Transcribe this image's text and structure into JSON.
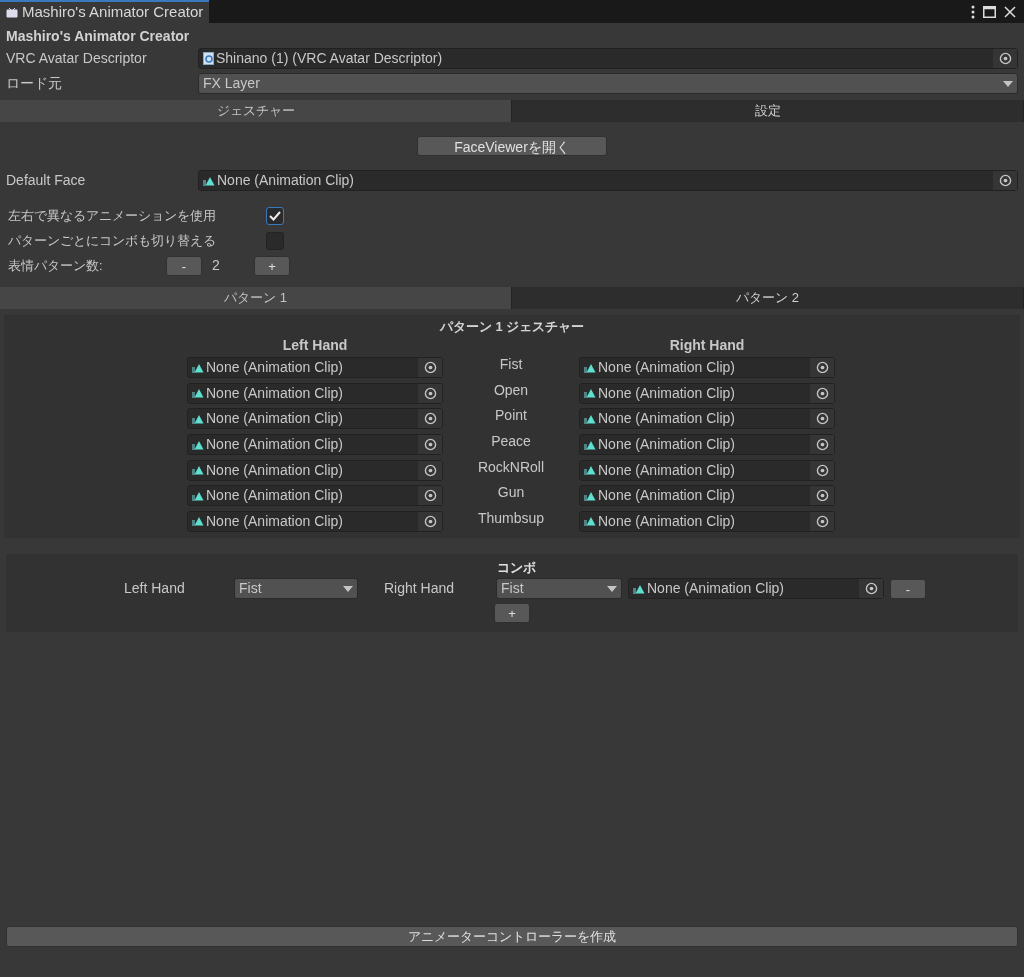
{
  "window": {
    "title": "Mashiro's Animator Creator"
  },
  "header": "Mashiro's Animator Creator",
  "fields": [
    {
      "kind": "object",
      "label": "VRC Avatar Descriptor",
      "value": "Shinano (1) (VRC Avatar Descriptor)"
    },
    {
      "kind": "dropdown",
      "label": "ロード元",
      "value": "FX Layer"
    }
  ],
  "main_tabs": [
    {
      "label": "ジェスチャー",
      "selected": true
    },
    {
      "label": "設定",
      "selected": false
    }
  ],
  "face_viewer_button": "FaceViewerを開く",
  "default_face": {
    "label": "Default Face",
    "value": "None (Animation Clip)"
  },
  "options": [
    {
      "label": "左右で異なるアニメーションを使用",
      "checked": true
    },
    {
      "label": "パターンごとにコンボも切り替える",
      "checked": false
    }
  ],
  "pattern_count": {
    "label": "表情パターン数:",
    "value": "2",
    "minus": "-",
    "plus": "+"
  },
  "pattern_tabs": [
    {
      "label": "パターン 1",
      "selected": true
    },
    {
      "label": "パターン 2",
      "selected": false
    }
  ],
  "gesture_panel": {
    "title": "パターン 1 ジェスチャー",
    "left_header": "Left Hand",
    "right_header": "Right Hand",
    "rows": [
      {
        "gesture": "Fist",
        "left": "None (Animation Clip)",
        "right": "None (Animation Clip)"
      },
      {
        "gesture": "Open",
        "left": "None (Animation Clip)",
        "right": "None (Animation Clip)"
      },
      {
        "gesture": "Point",
        "left": "None (Animation Clip)",
        "right": "None (Animation Clip)"
      },
      {
        "gesture": "Peace",
        "left": "None (Animation Clip)",
        "right": "None (Animation Clip)"
      },
      {
        "gesture": "RockNRoll",
        "left": "None (Animation Clip)",
        "right": "None (Animation Clip)"
      },
      {
        "gesture": "Gun",
        "left": "None (Animation Clip)",
        "right": "None (Animation Clip)"
      },
      {
        "gesture": "Thumbsup",
        "left": "None (Animation Clip)",
        "right": "None (Animation Clip)"
      }
    ]
  },
  "combo": {
    "title": "コンボ",
    "left_label": "Left Hand",
    "left_value": "Fist",
    "right_label": "Right Hand",
    "right_value": "Fist",
    "clip": "None (Animation Clip)",
    "remove": "-",
    "add": "+"
  },
  "create_button": "アニメーターコントローラーを作成"
}
